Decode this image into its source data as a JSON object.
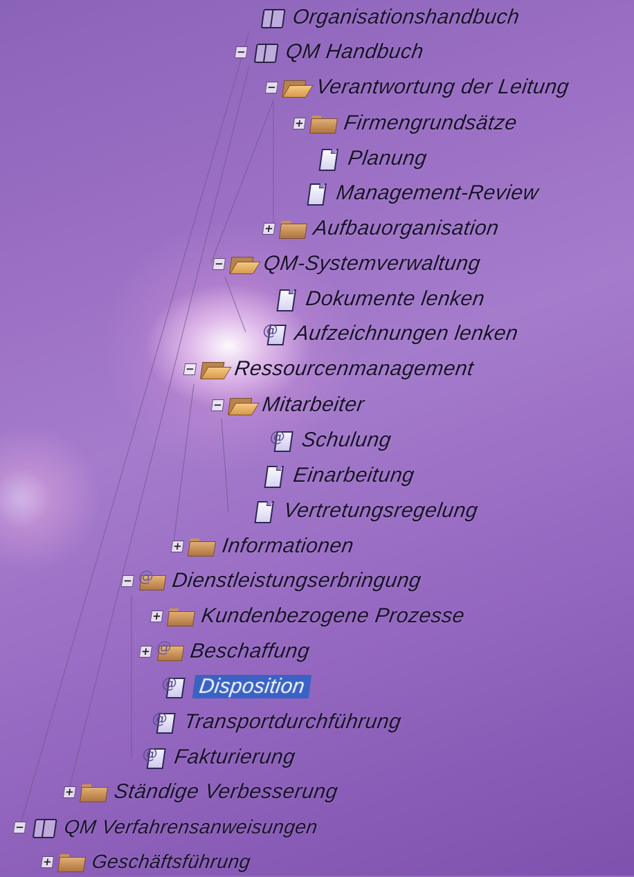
{
  "tree": {
    "items": [
      {
        "label": "Organisationshandbuch",
        "icon": "book-icon",
        "toggle": ""
      },
      {
        "label": "QM Handbuch",
        "icon": "book-icon",
        "toggle": "−"
      },
      {
        "label": "Verantwortung der Leitung",
        "icon": "folder-open-icon",
        "toggle": "−"
      },
      {
        "label": "Firmengrundsätze",
        "icon": "folder-closed-icon",
        "toggle": "+"
      },
      {
        "label": "Planung",
        "icon": "document-icon",
        "toggle": ""
      },
      {
        "label": "Management-Review",
        "icon": "document-icon",
        "toggle": ""
      },
      {
        "label": "Aufbauorganisation",
        "icon": "folder-closed-icon",
        "toggle": "+"
      },
      {
        "label": "QM-Systemverwaltung",
        "icon": "folder-open-icon",
        "toggle": "−"
      },
      {
        "label": "Dokumente lenken",
        "icon": "document-icon",
        "toggle": ""
      },
      {
        "label": "Aufzeichnungen lenken",
        "icon": "attachment-document-icon",
        "toggle": ""
      },
      {
        "label": "Ressourcenmanagement",
        "icon": "folder-open-icon",
        "toggle": "−"
      },
      {
        "label": "Mitarbeiter",
        "icon": "folder-open-icon",
        "toggle": "−"
      },
      {
        "label": "Schulung",
        "icon": "attachment-document-icon",
        "toggle": ""
      },
      {
        "label": "Einarbeitung",
        "icon": "document-icon",
        "toggle": ""
      },
      {
        "label": "Vertretungsregelung",
        "icon": "document-icon",
        "toggle": ""
      },
      {
        "label": "Informationen",
        "icon": "folder-closed-icon",
        "toggle": "+"
      },
      {
        "label": "Dienstleistungserbringung",
        "icon": "attachment-folder-icon",
        "toggle": "−"
      },
      {
        "label": "Kundenbezogene Prozesse",
        "icon": "folder-closed-icon",
        "toggle": "+"
      },
      {
        "label": "Beschaffung",
        "icon": "attachment-folder-icon",
        "toggle": "+"
      },
      {
        "label": "Disposition",
        "icon": "attachment-document-icon",
        "toggle": "",
        "selected": true
      },
      {
        "label": "Transportdurchführung",
        "icon": "attachment-document-icon",
        "toggle": ""
      },
      {
        "label": "Fakturierung",
        "icon": "attachment-document-icon",
        "toggle": ""
      },
      {
        "label": "Ständige Verbesserung",
        "icon": "folder-closed-icon",
        "toggle": "+"
      },
      {
        "label": "QM Verfahrensanweisungen",
        "icon": "book-icon",
        "toggle": "−"
      },
      {
        "label": "Geschäftsführung",
        "icon": "folder-closed-icon",
        "toggle": "+"
      }
    ]
  },
  "colors": {
    "selection": "#3a62c4",
    "text": "#18122a"
  }
}
